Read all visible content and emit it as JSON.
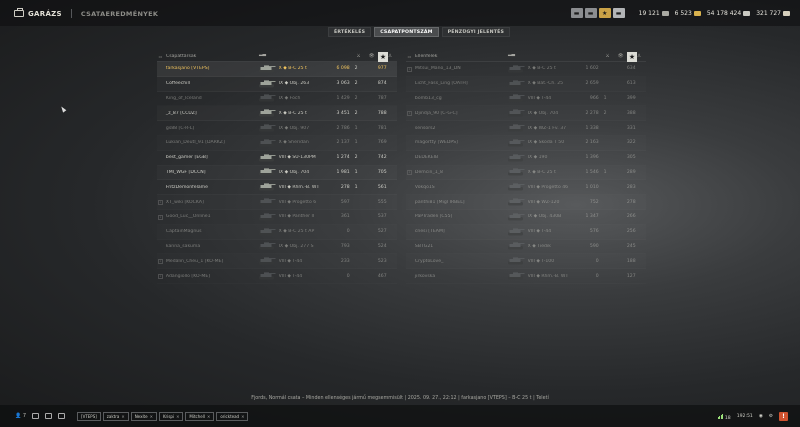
{
  "topbar": {
    "garage_label": "GARÁZS",
    "results_label": "CSATAEREDMÉNYEK",
    "currencies": [
      {
        "name": "silver",
        "value": "19 121",
        "color": "#bfbfb8"
      },
      {
        "name": "gold",
        "value": "6 523",
        "color": "#d9b24e"
      },
      {
        "name": "credits",
        "value": "54 178 424",
        "color": "#c9c9c2"
      },
      {
        "name": "free-xp",
        "value": "321 727",
        "color": "#d6d0bd"
      }
    ]
  },
  "tabs": [
    {
      "label": "ÉRTÉKELÉS",
      "active": false
    },
    {
      "label": "CSAPATPONTSZÁM",
      "active": true
    },
    {
      "label": "PÉNZÜGYI JELENTÉS",
      "active": false
    }
  ],
  "left_team": {
    "header": {
      "title": "Csapattársak",
      "star": "★",
      "frags_icon": "⚔",
      "spot_icon": "👁"
    },
    "rows": [
      {
        "platform": "",
        "name": "farkasjano [VTEPS]",
        "tank_tier": "X",
        "tank": "B-C 25 t",
        "damage": "6 098",
        "frags": "2",
        "xp": "977",
        "me": true,
        "dead": false
      },
      {
        "platform": "",
        "name": "Coffeechill",
        "tank_tier": "IX",
        "tank": "Obj. 263",
        "damage": "3 063",
        "frags": "2",
        "xp": "874",
        "me": false,
        "dead": false
      },
      {
        "platform": "",
        "name": "King_of_Iceland",
        "tank_tier": "IX",
        "tank": "Foch",
        "damage": "1 429",
        "frags": "2",
        "xp": "787",
        "me": false,
        "dead": true
      },
      {
        "platform": "",
        "name": "_z_87 [CCUZ]",
        "tank_tier": "X",
        "tank": "B-C 25 t",
        "damage": "3 451",
        "frags": "2",
        "xp": "788",
        "me": false,
        "dead": false
      },
      {
        "platform": "",
        "name": "gs88 [C-R-L]",
        "tank_tier": "IX",
        "tank": "Obj. 907",
        "damage": "2 786",
        "frags": "1",
        "xp": "781",
        "me": false,
        "dead": true
      },
      {
        "platform": "",
        "name": "Lukian_Deutl_91 [DARKZ]",
        "tank_tier": "X",
        "tank": "Sheridan",
        "damage": "2 137",
        "frags": "1",
        "xp": "769",
        "me": false,
        "dead": true
      },
      {
        "platform": "",
        "name": "best_gamer [EGB]",
        "tank_tier": "VIII",
        "tank": "SU-130PM",
        "damage": "1 274",
        "frags": "2",
        "xp": "742",
        "me": false,
        "dead": false
      },
      {
        "platform": "",
        "name": "TMI_WGF [DCCN]",
        "tank_tier": "IX",
        "tank": "Obj. 704",
        "damage": "1 981",
        "frags": "1",
        "xp": "705",
        "me": false,
        "dead": false
      },
      {
        "platform": "",
        "name": "FritzDemonfelame",
        "tank_tier": "VIII",
        "tank": "Rhm.-B. WT",
        "damage": "278",
        "frags": "1",
        "xp": "561",
        "me": false,
        "dead": false
      },
      {
        "platform": "1",
        "name": "XT_wiki [KOCKA]",
        "tank_tier": "VIII",
        "tank": "Progetto 6",
        "damage": "597",
        "frags": "",
        "xp": "555",
        "me": false,
        "dead": true
      },
      {
        "platform": "1",
        "name": "Good_Luc__Online1",
        "tank_tier": "VIII",
        "tank": "Panther II",
        "damage": "361",
        "frags": "",
        "xp": "537",
        "me": false,
        "dead": true
      },
      {
        "platform": "",
        "name": "CaptainMagnus",
        "tank_tier": "X",
        "tank": "B-C 25 t AP",
        "damage": "0",
        "frags": "",
        "xp": "527",
        "me": false,
        "dead": true
      },
      {
        "platform": "",
        "name": "kanna_sakuma",
        "tank_tier": "IX",
        "tank": "Obj. 277 S",
        "damage": "793",
        "frags": "",
        "xp": "524",
        "me": false,
        "dead": true
      },
      {
        "platform": "1",
        "name": "Medalin_Cheu_1 [KO-ME]",
        "tank_tier": "VIII",
        "tank": "T-44",
        "damage": "233",
        "frags": "",
        "xp": "523",
        "me": false,
        "dead": true
      },
      {
        "platform": "1",
        "name": "Adangiollo [KO-ME]",
        "tank_tier": "VIII",
        "tank": "T-44",
        "damage": "0",
        "frags": "",
        "xp": "467",
        "me": false,
        "dead": true
      }
    ]
  },
  "right_team": {
    "header": {
      "title": "Ellenfelek",
      "star": "★",
      "frags_icon": "⚔",
      "spot_icon": "👁"
    },
    "rows": [
      {
        "platform": "1",
        "name": "Mitsui_Mano_13_DN",
        "tank_tier": "X",
        "tank": "B-C 25 t",
        "damage": "1 602",
        "frags": "",
        "xp": "634",
        "dead": true
      },
      {
        "platform": "",
        "name": "Licht_Fass_Ling [OATH]",
        "tank_tier": "X",
        "tank": "Bat.-Ch. 25",
        "damage": "2 659",
        "frags": "",
        "xp": "613",
        "dead": true
      },
      {
        "platform": "",
        "name": "bomb13_cg",
        "tank_tier": "VIII",
        "tank": "T-44",
        "damage": "966",
        "frags": "1",
        "xp": "399",
        "dead": true
      },
      {
        "platform": "1",
        "name": "Djindja_90 [C-G-C]",
        "tank_tier": "IX",
        "tank": "Obj. 704",
        "damage": "2 278",
        "frags": "2",
        "xp": "388",
        "dead": true
      },
      {
        "platform": "",
        "name": "sensors2",
        "tank_tier": "IX",
        "tank": "WZ-1 Fv. 37",
        "damage": "1 338",
        "frags": "",
        "xp": "331",
        "dead": true
      },
      {
        "platform": "",
        "name": "magortty [WEDPS]",
        "tank_tier": "IX",
        "tank": "Škoda T 50",
        "damage": "2 163",
        "frags": "",
        "xp": "322",
        "dead": true
      },
      {
        "platform": "",
        "name": "DEDEKEIB",
        "tank_tier": "IX",
        "tank": "190",
        "damage": "1 396",
        "frags": "",
        "xp": "305",
        "dead": true
      },
      {
        "platform": "1",
        "name": "Demcin_1_8",
        "tank_tier": "X",
        "tank": "B-C 25 t",
        "damage": "1 546",
        "frags": "1",
        "xp": "289",
        "dead": true
      },
      {
        "platform": "",
        "name": "Vokqo1S",
        "tank_tier": "VIII",
        "tank": "Progetto 46",
        "damage": "1 010",
        "frags": "",
        "xp": "283",
        "dead": true
      },
      {
        "platform": "",
        "name": "panthi81 [MigI IRBEL]",
        "tank_tier": "VIII",
        "tank": "WZ-120",
        "damage": "752",
        "frags": "",
        "xp": "278",
        "dead": true
      },
      {
        "platform": "",
        "name": "PaPTradeli [C55]",
        "tank_tier": "IX",
        "tank": "Obj. 430B",
        "damage": "1 347",
        "frags": "",
        "xp": "266",
        "dead": true
      },
      {
        "platform": "",
        "name": "cnesi [TEAM]",
        "tank_tier": "VIII",
        "tank": "T-44",
        "damage": "576",
        "frags": "",
        "xp": "256",
        "dead": true
      },
      {
        "platform": "",
        "name": "SBTG21",
        "tank_tier": "X",
        "tank": "Tiedik",
        "damage": "590",
        "frags": "",
        "xp": "245",
        "dead": true
      },
      {
        "platform": "",
        "name": "CryptoLove_",
        "tank_tier": "VIII",
        "tank": "T-100",
        "damage": "0",
        "frags": "",
        "xp": "188",
        "dead": true
      },
      {
        "platform": "",
        "name": "jirkovska",
        "tank_tier": "VIII",
        "tank": "Rhm.-B. WT",
        "damage": "0",
        "frags": "",
        "xp": "127",
        "dead": true
      }
    ]
  },
  "battle_info": "Fjords, Normál csata – Minden ellenséges jármű megsemmisült   |   2025. 09. 27., 22:12   |   farkasjano [VTEPS] – B-C 25 t   |   Teletí",
  "bottombar": {
    "players_count": "7",
    "chips": [
      "[VTEPS]",
      "zaktra",
      "Nexite",
      "Krispi",
      "Mitchell",
      "oricktead"
    ],
    "counter": "18",
    "ping": "192:51"
  }
}
